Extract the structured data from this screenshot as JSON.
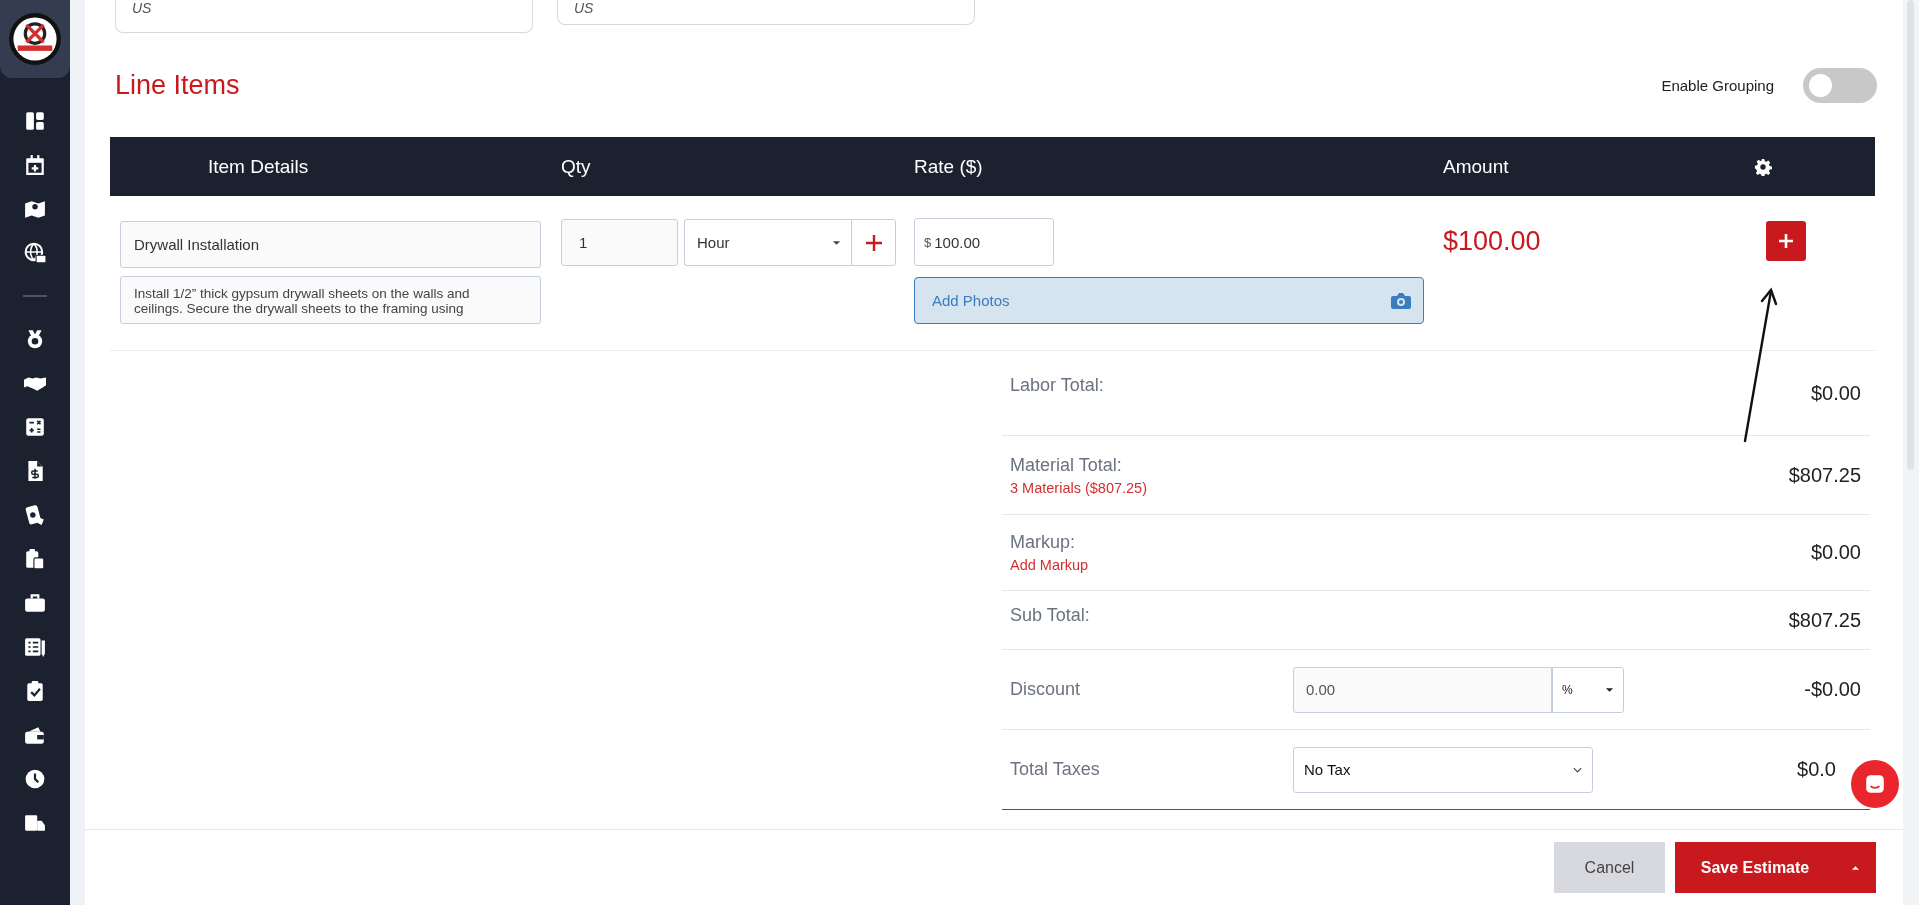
{
  "address_fields": [
    {
      "value": "US"
    },
    {
      "value": "US"
    }
  ],
  "line_items": {
    "title": "Line Items",
    "grouping": {
      "label": "Enable Grouping",
      "on": false
    },
    "columns": [
      "Item Details",
      "Qty",
      "Rate ($)",
      "Amount"
    ],
    "rows": [
      {
        "name": "Drywall Installation",
        "description": "Install 1/2” thick gypsum drywall sheets on the walls and ceilings. Secure the drywall sheets to the framing using",
        "qty": "1",
        "unit": "Hour",
        "currency": "$",
        "rate": "100.00",
        "photos_label": "Add Photos",
        "amount": "$100.00"
      }
    ]
  },
  "summary": [
    {
      "kind": "plain",
      "label": "Labor Total:",
      "value": "$0.00"
    },
    {
      "kind": "link",
      "label": "Material Total:",
      "link": "3 Materials ($807.25)",
      "value": "$807.25"
    },
    {
      "kind": "link",
      "label": "Markup:",
      "link": "Add Markup",
      "value": "$0.00"
    },
    {
      "kind": "plain",
      "label": "Sub Total:",
      "value": "$807.25"
    },
    {
      "kind": "discount",
      "label": "Discount",
      "input": "0.00",
      "unit": "%",
      "value": "-$0.00"
    },
    {
      "kind": "select",
      "label": "Total Taxes",
      "input": "No Tax",
      "value": "$0.0"
    }
  ],
  "footer": {
    "cancel": "Cancel",
    "save": "Save Estimate"
  }
}
